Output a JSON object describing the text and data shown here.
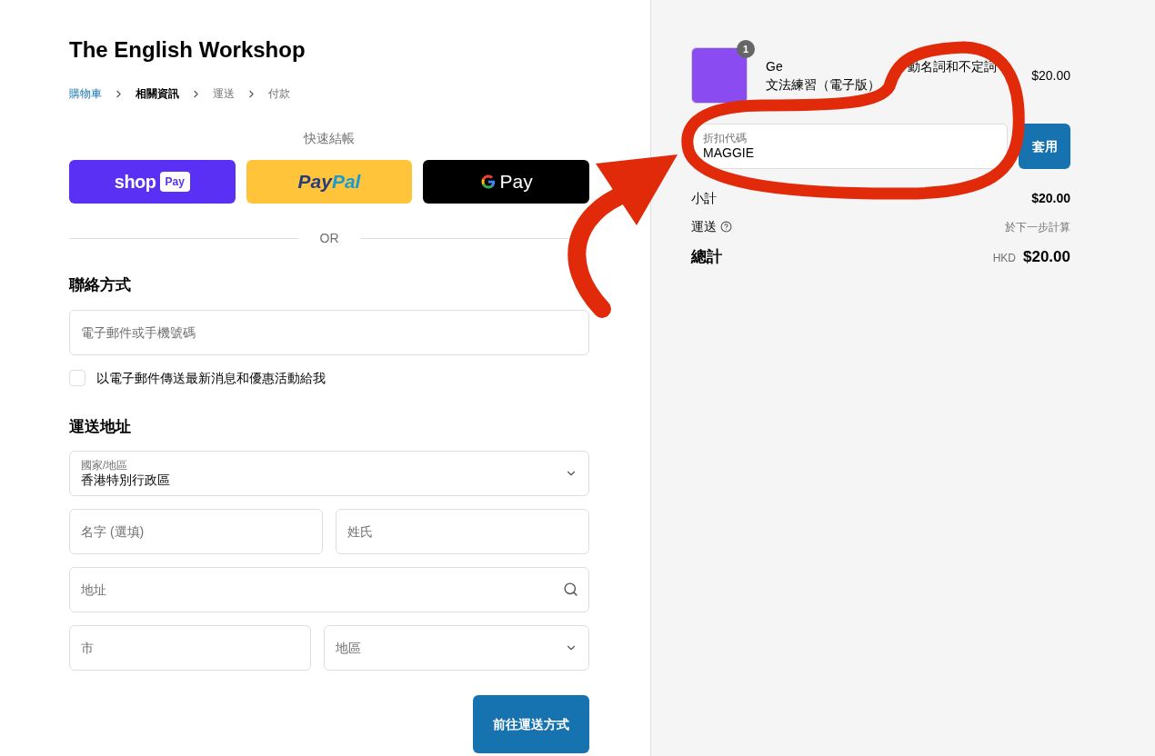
{
  "store_title": "The English Workshop",
  "breadcrumb": [
    {
      "label": "購物車",
      "kind": "link"
    },
    {
      "label": "相關資訊",
      "kind": "current"
    },
    {
      "label": "運送",
      "kind": "pending"
    },
    {
      "label": "付款",
      "kind": "pending"
    }
  ],
  "express_checkout": {
    "label": "快速結帳",
    "buttons": [
      {
        "kind": "shop",
        "text": "shop",
        "badge": "Pay"
      },
      {
        "kind": "paypal",
        "text": "Pay",
        "text2": "Pal"
      },
      {
        "kind": "gpay",
        "text": "Pay"
      }
    ]
  },
  "divider": "OR",
  "contact": {
    "heading": "聯絡方式",
    "email": {
      "placeholder": "電子郵件或手機號碼"
    },
    "newsletter": {
      "label": "以電子郵件傳送最新消息和優惠活動給我",
      "checked": false
    }
  },
  "shipping": {
    "heading": "運送地址",
    "rows": [
      [
        {
          "kind": "select",
          "label": "國家/地區",
          "value": "香港特別行政區"
        }
      ],
      [
        {
          "kind": "text",
          "placeholder": "名字 (選填)"
        },
        {
          "kind": "text",
          "placeholder": "姓氏"
        }
      ],
      [
        {
          "kind": "search",
          "placeholder": "地址"
        }
      ],
      [
        {
          "kind": "text",
          "placeholder": "市"
        },
        {
          "kind": "select",
          "placeholder": "地區"
        }
      ]
    ]
  },
  "continue_button": "前往運送方式",
  "summary": {
    "product": {
      "quantity": "1",
      "title_line1": [
        "Ge",
        "動名詞和不定詞"
      ],
      "title_line2": "文法練習（電子版）",
      "price": "$20.00"
    },
    "discount": {
      "label": "折扣代碼",
      "value": "MAGGIE"
    },
    "apply_button": "套用",
    "rows": [
      {
        "kind": "subtotal",
        "label": "小計",
        "value": "$20.00"
      },
      {
        "kind": "shipping",
        "label": "運送",
        "value": "於下一步計算"
      },
      {
        "kind": "total",
        "label": "總計",
        "currency": "HKD",
        "value": "$20.00"
      }
    ]
  }
}
